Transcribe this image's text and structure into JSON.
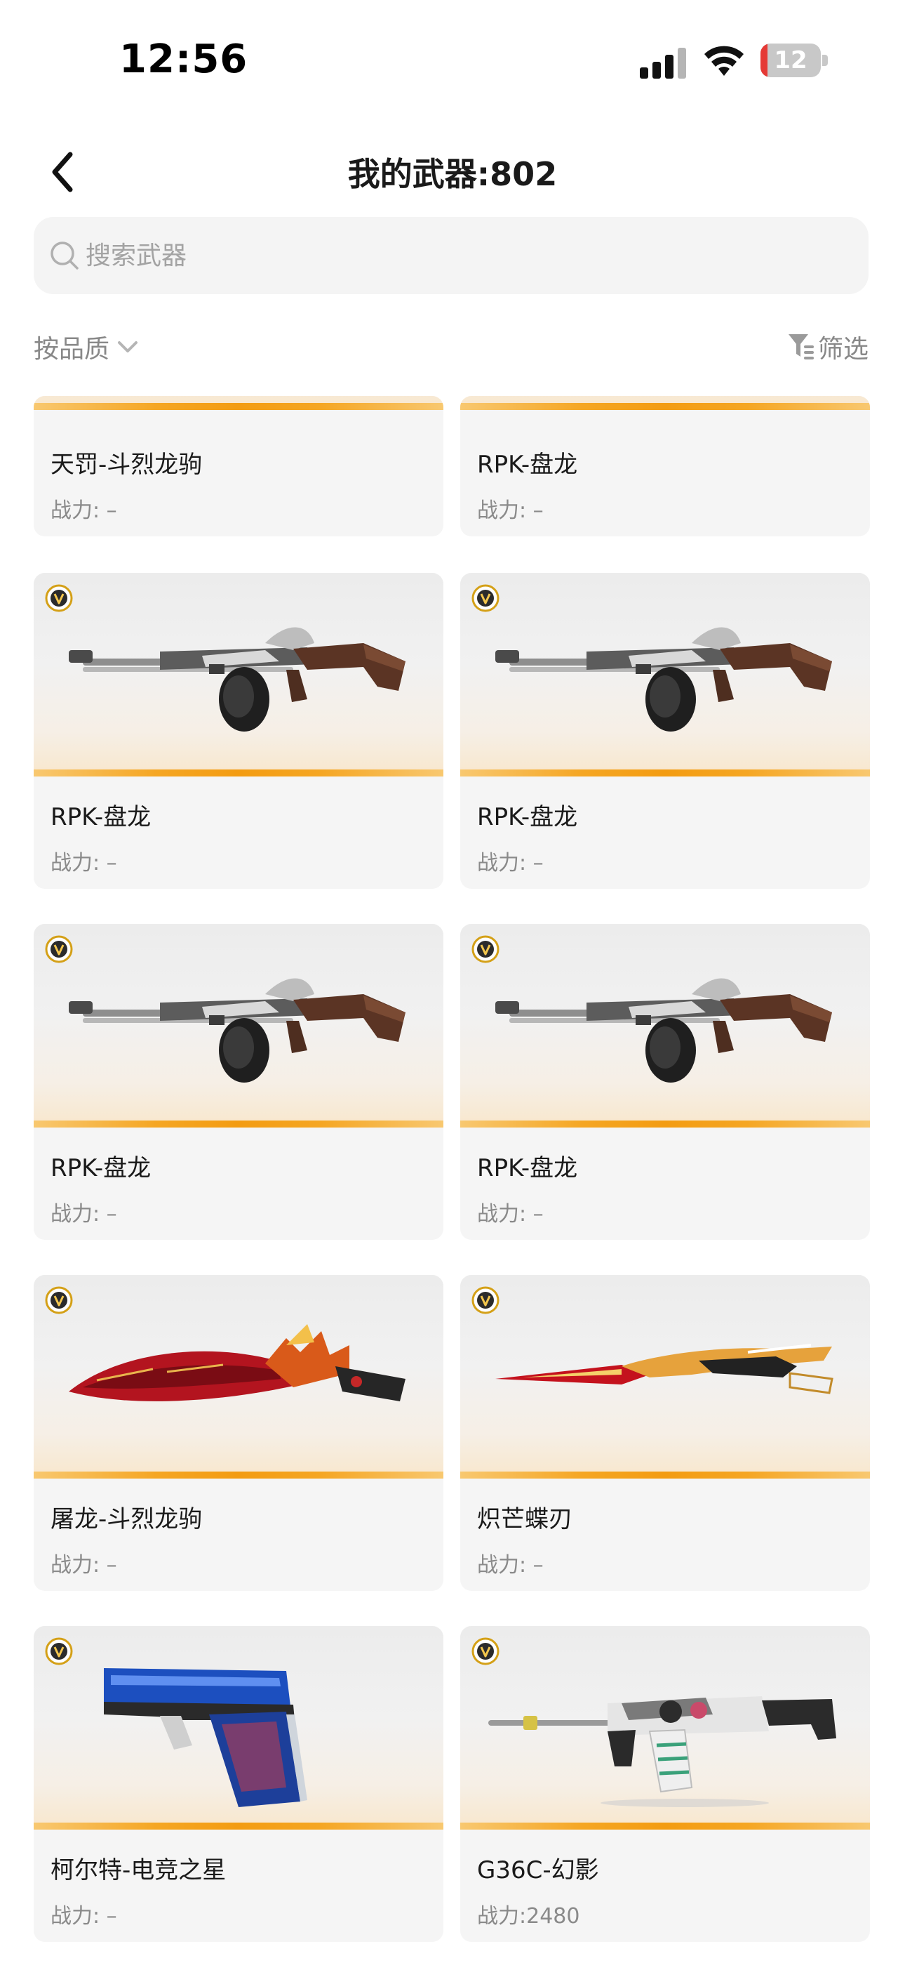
{
  "status_bar": {
    "time": "12:56",
    "battery_level": "12",
    "battery_fraction": 0.12
  },
  "header": {
    "title": "我的武器:802",
    "back_icon": "chevron-left-icon"
  },
  "search": {
    "placeholder": "搜索武器",
    "value": "",
    "icon": "search-icon"
  },
  "toolbar": {
    "sort_label": "按品质",
    "filter_label": "筛选",
    "sort_icon": "chevron-down-icon",
    "filter_icon": "filter-icon"
  },
  "colors": {
    "accent_stripe": "#f5a623",
    "battery_low": "#e53935"
  },
  "weapons": [
    {
      "name": "天罚-斗烈龙驹",
      "power": "战力: –",
      "art": ""
    },
    {
      "name": "RPK-盘龙",
      "power": "战力: –",
      "art": ""
    },
    {
      "name": "RPK-盘龙",
      "power": "战力: –",
      "art": "rifle"
    },
    {
      "name": "RPK-盘龙",
      "power": "战力: –",
      "art": "rifle"
    },
    {
      "name": "RPK-盘龙",
      "power": "战力: –",
      "art": "rifle"
    },
    {
      "name": "RPK-盘龙",
      "power": "战力: –",
      "art": "rifle"
    },
    {
      "name": "屠龙-斗烈龙驹",
      "power": "战力: –",
      "art": "dragon-blade"
    },
    {
      "name": "炽芒蝶刃",
      "power": "战力: –",
      "art": "butterfly-blade"
    },
    {
      "name": "柯尔特-电竞之星",
      "power": "战力: –",
      "art": "pistol"
    },
    {
      "name": "G36C-幻影",
      "power": "战力:2480",
      "art": "smg"
    }
  ]
}
